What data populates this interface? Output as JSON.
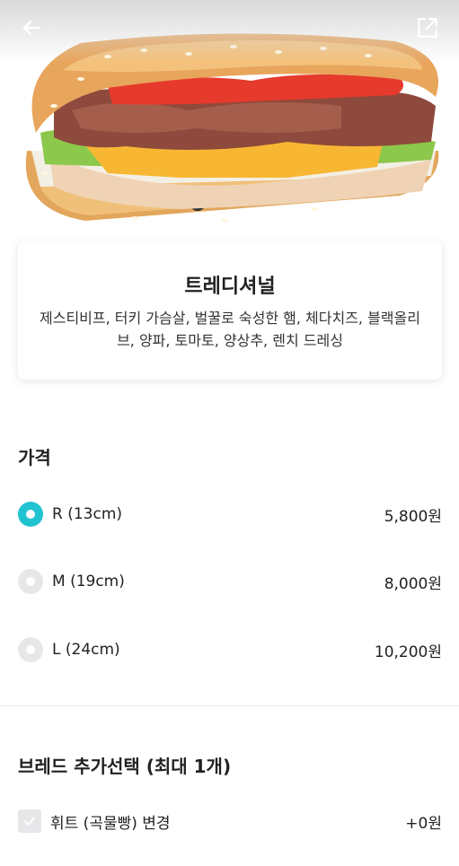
{
  "menu": {
    "name": "트레디셔널",
    "description": "제스티비프, 터키 가슴살, 벌꿀로 숙성한 햄, 체다치즈, 블랙올리브, 양파, 토마토, 양상추, 렌치 드레싱"
  },
  "header": {
    "back_icon": "arrow-left-icon",
    "share_icon": "share-icon"
  },
  "price_section": {
    "title": "가격",
    "options": [
      {
        "label": "R (13cm)",
        "price": "5,800원",
        "selected": true
      },
      {
        "label": "M (19cm)",
        "price": "8,000원",
        "selected": false
      },
      {
        "label": "L (24cm)",
        "price": "10,200원",
        "selected": false
      }
    ]
  },
  "bread_section": {
    "title": "브레드 추가선택 (최대 1개)",
    "options": [
      {
        "label": "휘트 (곡물빵) 변경",
        "price": "+0원",
        "checked": false
      }
    ]
  },
  "colors": {
    "accent": "#22c3d1",
    "unselected": "#e7e7ea"
  }
}
